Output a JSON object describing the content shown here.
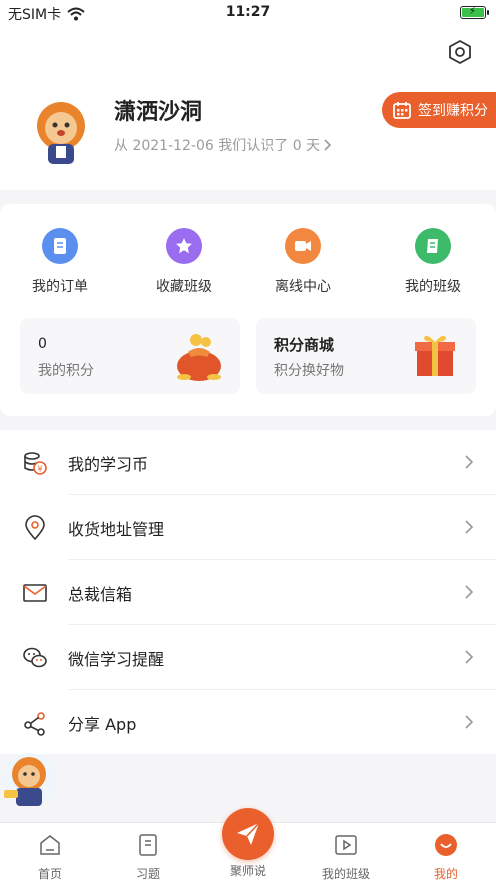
{
  "status": {
    "carrier": "无SIM卡",
    "time": "11:27"
  },
  "profile": {
    "name": "潇洒沙洞",
    "since": "从 2021-12-06 我们认识了 0 天",
    "checkin_label": "签到赚积分"
  },
  "quick_actions": [
    {
      "label": "我的订单",
      "icon": "order-icon",
      "color": "#5a8ff0"
    },
    {
      "label": "收藏班级",
      "icon": "star-icon",
      "color": "#9a6df0"
    },
    {
      "label": "离线中心",
      "icon": "video-icon",
      "color": "#f2873f"
    },
    {
      "label": "我的班级",
      "icon": "book-icon",
      "color": "#3dbb6b"
    }
  ],
  "points": {
    "value": "0",
    "label": "我的积分"
  },
  "mall": {
    "title": "积分商城",
    "subtitle": "积分换好物"
  },
  "menu": [
    {
      "label": "我的学习币",
      "icon": "coin-icon"
    },
    {
      "label": "收货地址管理",
      "icon": "location-icon"
    },
    {
      "label": "总裁信箱",
      "icon": "mail-icon"
    },
    {
      "label": "微信学习提醒",
      "icon": "wechat-icon"
    },
    {
      "label": "分享 App",
      "icon": "share-icon"
    }
  ],
  "tabs": [
    {
      "label": "首页",
      "icon": "home-icon"
    },
    {
      "label": "习题",
      "icon": "exercise-icon"
    },
    {
      "label": "聚师说",
      "icon": "send-icon"
    },
    {
      "label": "我的班级",
      "icon": "class-icon"
    },
    {
      "label": "我的",
      "icon": "profile-icon"
    }
  ],
  "active_tab": "我的",
  "colors": {
    "accent": "#e9602c",
    "background": "#f5f5f7"
  }
}
